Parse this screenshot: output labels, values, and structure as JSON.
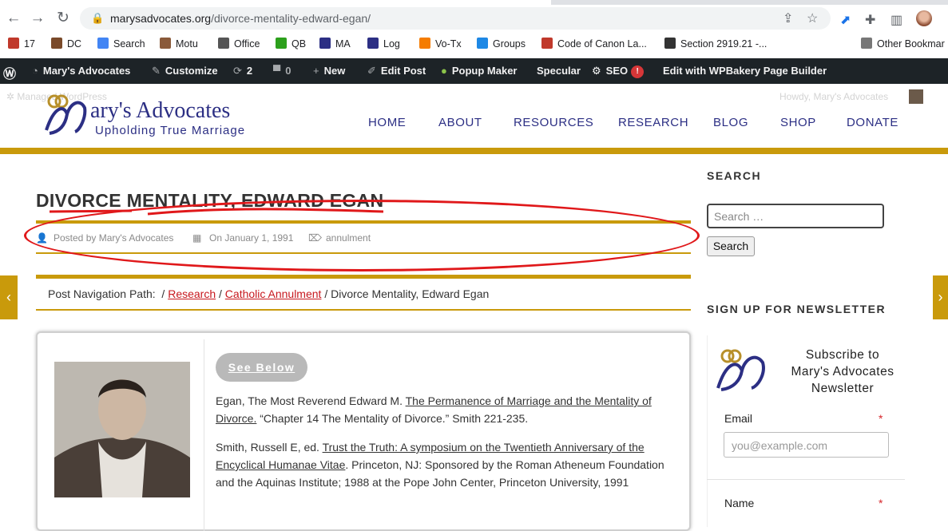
{
  "browser": {
    "url_domain": "marysadvocates.org",
    "url_path": "/divorce-mentality-edward-egan/",
    "bookmarks": [
      {
        "label": "17",
        "color": "#c0392b"
      },
      {
        "label": "DC",
        "color": "#7a4a2a"
      },
      {
        "label": "Search",
        "color": "#4285f4"
      },
      {
        "label": "Motu",
        "color": "#8a5a3a"
      },
      {
        "label": "Office",
        "color": "#555555"
      },
      {
        "label": "QB",
        "color": "#2ca01c"
      },
      {
        "label": "MA",
        "color": "#2c2f84"
      },
      {
        "label": "Log",
        "color": "#2c2f84"
      },
      {
        "label": "Vo-Tx",
        "color": "#f57c00"
      },
      {
        "label": "Groups",
        "color": "#1e88e5"
      },
      {
        "label": "Code of Canon La...",
        "color": "#c0392b"
      },
      {
        "label": "Section 2919.21 -...",
        "color": "#333333"
      },
      {
        "label": "Other Bookmar",
        "color": "#777777"
      }
    ]
  },
  "adminbar": {
    "site": "Mary's Advocates",
    "customize": "Customize",
    "updates": "2",
    "comments": "0",
    "new": "New",
    "edit_post": "Edit Post",
    "popup": "Popup Maker",
    "specular": "Specular",
    "seo": "SEO",
    "seo_badge": "!",
    "wpbakery": "Edit with WPBakery Page Builder"
  },
  "header": {
    "watermark_left": "Managed WordPress",
    "watermark_right": "Howdy, Mary's Advocates",
    "logo_title": "ary's Advocates",
    "logo_sub": "Upholding True Marriage",
    "nav": [
      "HOME",
      "ABOUT",
      "RESOURCES",
      "RESEARCH",
      "BLOG",
      "SHOP",
      "DONATE"
    ]
  },
  "post": {
    "title": "DIVORCE MENTALITY, EDWARD EGAN",
    "author": "Posted by Mary's Advocates",
    "date": "On January 1, 1991",
    "tag": "annulment",
    "crumb_label": "Post Navigation Path:",
    "crumb_research": "Research",
    "crumb_annulment": "Catholic Annulment",
    "crumb_current": "Divorce Mentality, Edward Egan",
    "see_below": "See Below",
    "ref1_lead": "Egan, The Most Reverend Edward M.",
    "ref1_link": "The Permanence of Marriage and the Mentality of Divorce.",
    "ref1_tail": "“Chapter 14 The Mentality of Divorce.” Smith 221-235.",
    "ref2_lead": "Smith, Russell E, ed.",
    "ref2_link": "Trust the Truth: A symposium on the Twentieth Anniversary of the Encyclical Humanae Vitae",
    "ref2_tail": ". Princeton, NJ: Sponsored by the Roman Atheneum Foundation and the Aquinas Institute; 1988 at the Pope John Center, Princeton University, 1991"
  },
  "sidebar": {
    "search_heading": "SEARCH",
    "search_placeholder": "Search …",
    "search_button": "Search",
    "newsletter_heading": "SIGN UP FOR NEWSLETTER",
    "newsletter_text": "Subscribe to Mary's Advocates Newsletter",
    "email_label": "Email",
    "email_placeholder": "you@example.com",
    "name_label": "Name",
    "required_mark": "*"
  },
  "colors": {
    "gold": "#c99a0b",
    "navy": "#2c2f84",
    "admin_bg": "#1d2327",
    "link_red": "#c7181e",
    "annotation_red": "#e0181a"
  }
}
